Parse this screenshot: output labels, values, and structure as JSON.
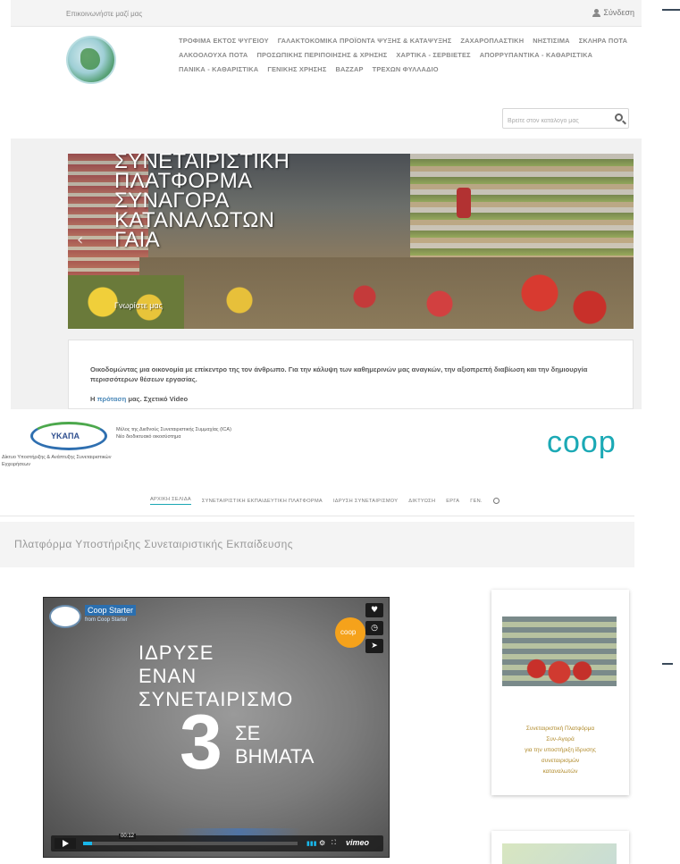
{
  "shop": {
    "topbar": {
      "contact": "Επικοινωνήστε μαζί μας",
      "login": "Σύνδεση"
    },
    "nav": [
      "ΤΡΟΦΙΜΑ ΕΚΤΟΣ ΨΥΓΕΙΟΥ",
      "ΓΑΛΑΚΤΟΚΟΜΙΚΑ ΠΡΟΪΟΝΤΑ ΨΥΞΗΣ & ΚΑΤΑΨΥΞΗΣ",
      "ΖΑΧΑΡΟΠΛΑΣΤΙΚΗ",
      "ΝΗΣΤΙΣΙΜΑ",
      "ΣΚΛΗΡΑ ΠΟΤΑ",
      "ΑΛΚΟΟΛΟΥΧΑ ΠΟΤΑ",
      "ΠΡΟΣΩΠΙΚΗΣ ΠΕΡΙΠΟΙΗΣΗΣ & ΧΡΗΣΗΣ",
      "ΧΑΡΤΙΚΑ - ΣΕΡΒΙΕΤΕΣ",
      "ΑΠΟΡΡΥΠΑΝΤΙΚΑ - ΚΑΘΑΡΙΣΤΙΚΑ",
      "ΠΑΝΙΚΑ - ΚΑΘΑΡΙΣΤΙΚΑ",
      "ΓΕΝΙΚΗΣ ΧΡΗΣΗΣ",
      "ΒΑΖΖΑΡ",
      "ΤΡΕΧΩΝ ΦΥΛΛΑΔΙΟ"
    ],
    "search": {
      "placeholder": "Βρείτε στον κατάλογο μας"
    },
    "hero": {
      "title": "ΣΥΝΕΤΑΙΡΙΣΤΙΚΗ\nΠΛΑΤΦΟΡΜΑ\nΣΥΝΑΓΟΡΑ\nΚΑΤΑΝΑΛΩΤΩΝ\nΓΑΙΑ",
      "subtitle": "Γνωρίστε μας"
    },
    "intro": {
      "text": "Οικοδομώντας μια οικονομία με επίκεντρο της τον άνθρωπο. Για την κάλυψη των καθημερινών μας αναγκών, την αξιοπρεπή διαβίωση και την δημιουργία περισσότερων θέσεων εργασίας.",
      "link_prefix": "Η ",
      "link": "πρόταση",
      "link_suffix": " μας. Σχετικό Video"
    }
  },
  "coop": {
    "logo_text": "ΥΚΑΠΑ",
    "logo_caption": "Δίκτυο Υποστήριξης & Ανάπτυξης Συνεταιριστικών Εγχειρήσεων",
    "org_text": "Μέλος της Διεθνούς Συνεταιριστικής Συμμαχίας (ICA)\nΝέο διοδικτυακό οικοσύστημα",
    "brand": "coop",
    "nav": [
      "ΑΡΧΙΚΗ ΣΕΛΙΔΑ",
      "ΣΥΝΕΤΑΙΡΙΣΤΙΚΗ ΕΚΠΑΙΔΕΥΤΙΚΗ ΠΛΑΤΦΟΡΜΑ",
      "ΙΔΡΥΣΗ ΣΥΝΕΤΑΙΡΙΣΜΟΥ",
      "ΔΙΚΤΥΩΣΗ",
      "ΕΡΓΑ",
      "ΓΕΝ."
    ],
    "band_title": "Πλατφόρμα Υποστήριξης Συνεταιριστικής Εκπαίδευσης",
    "video": {
      "channel": "Coop Starter",
      "from": "from Coop Starter",
      "badge": "coop",
      "lines": [
        "ΙΔΡΥΣΕ",
        "ΕΝΑΝ",
        "ΣΥΝΕΤΑΙΡΙΣΜΟ"
      ],
      "number": "3",
      "step_lines": [
        "ΣΕ",
        "ΒΗΜΑΤΑ"
      ],
      "time": "00:12",
      "progress": 0.04,
      "vimeo": "vimeo"
    },
    "side_card": {
      "text": "Συνεταιριστική Πλατφόρμα\nΣυν-Αγορά\nγια την υποστήριξη ίδρυσης\nσυνεταιρισμών\nκαταναλωτών"
    }
  }
}
